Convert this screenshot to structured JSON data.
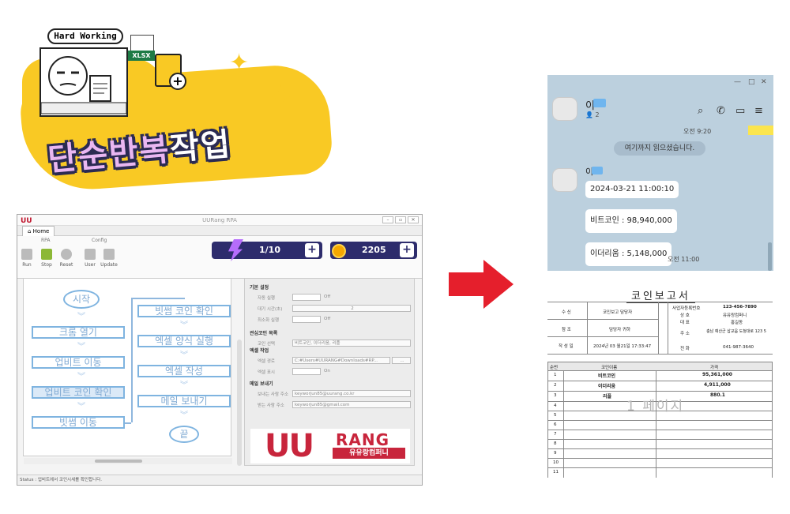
{
  "banner": {
    "speech": "Hard Working",
    "title_part1": "단순반복",
    "title_part2": "작업",
    "xlsx_tag": "XLSX"
  },
  "rpa": {
    "window_title": "UURang RPA",
    "tab_home": "Home",
    "groups": {
      "rpa": "RPA",
      "config": "Config"
    },
    "toolbar": {
      "run": "Run",
      "stop": "Stop",
      "reset": "Reset",
      "user": "User",
      "update": "Update"
    },
    "energy": "1/10",
    "coins": "2205",
    "flow": {
      "start": "시작",
      "steps_left": [
        "크롬 열기",
        "업비트 이동",
        "업비트 코인 확인",
        "빗썸 이동"
      ],
      "steps_right": [
        "빗썸 코인 확인",
        "엑셀 양식 실행",
        "엑셀 작성",
        "메일 보내기"
      ],
      "end": "끝"
    },
    "settings": {
      "basic_header": "기본 설정",
      "auto_run_label": "자동 실행",
      "auto_run_state": "Off",
      "interval_label": "대기 시간(초)",
      "interval_value": "2",
      "minimize_label": "최소화 실행",
      "minimize_state": "Off",
      "coin_header": "관심코인 목록",
      "coin_select_label": "코인 선택",
      "coin_select_value": "비트코인, 이더리움, 리플",
      "excel_header": "엑셀 작업",
      "excel_path_label": "엑셀 경로",
      "excel_path_value": "C:#Users#UURANG#Downloads#RP...",
      "excel_browse": "...",
      "excel_show_label": "엑셀 표시",
      "excel_show_state": "On",
      "mail_header": "메일 보내기",
      "mail_from_label": "보내는 사람 주소",
      "mail_from_value": "keyworjun85@uurang.co.kr",
      "mail_to_label": "받는 사람 주소",
      "mail_to_value": "keyworjun85@gmail.com"
    },
    "brand_uu": "UU",
    "brand_rang": "RANG",
    "brand_sub": "유유랑컴퍼니",
    "status": "Status : 업비트에서 코인시세를 확인합니다."
  },
  "kakao": {
    "chat_name": "이",
    "member_count": "2",
    "time_top": "오전 9:20",
    "notice": "여기까지 읽으셨습니다.",
    "sender_name": "이",
    "messages": [
      "2024-03-21 11:00:10",
      "비트코인 : 98,940,000",
      "이더리움 : 5,148,000"
    ],
    "time_bottom": "오전 11:00"
  },
  "report": {
    "title": "코인보고서",
    "recipient_label": "수 신",
    "recipient_value": "코인보고 담당자",
    "cc_label": "참 조",
    "cc_value": "담당자 귀하",
    "date_label": "작 성 일",
    "date_value": "2024년 03 월21일 17:33:47",
    "company": {
      "reg_label": "사업자등록번호",
      "reg_value": "123-456-7890",
      "name_label": "상 호",
      "name_value": "유유랑컴퍼니",
      "ceo_label": "대 표",
      "ceo_value": "홍길동",
      "addr_label": "주 소",
      "addr_value": "충남 예산군 삽교읍 도청대로 123 5",
      "tel_label": "전 화",
      "tel_value": "041-987-3640"
    },
    "columns": [
      "순번",
      "코인이름",
      "가격"
    ],
    "rows": [
      {
        "no": "1",
        "name": "비트코인",
        "price": "95,361,000"
      },
      {
        "no": "2",
        "name": "이더리움",
        "price": "4,911,000"
      },
      {
        "no": "3",
        "name": "리플",
        "price": "880.1"
      }
    ],
    "empty_rows": [
      "4",
      "5",
      "6",
      "7",
      "8",
      "9",
      "10",
      "11"
    ],
    "watermark": "1 페이지"
  }
}
